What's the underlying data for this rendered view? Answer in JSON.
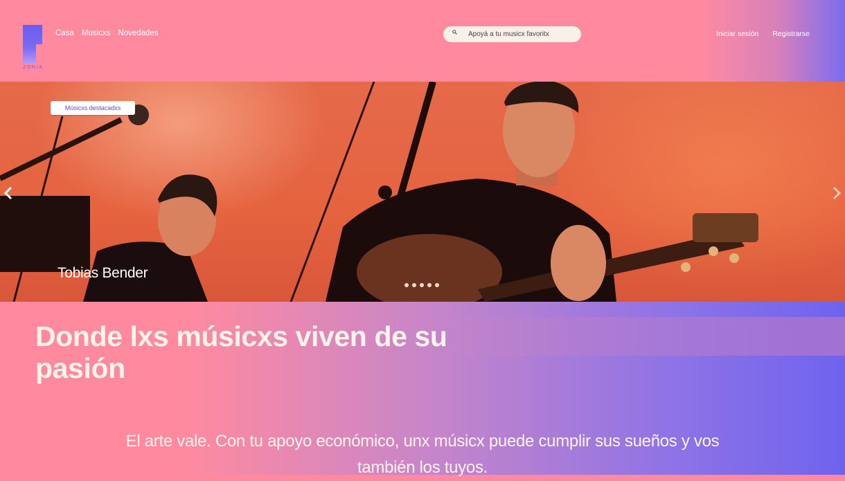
{
  "brand": {
    "logo_text": "ZONIA"
  },
  "nav": {
    "items": [
      {
        "label": "Casa"
      },
      {
        "label": "Musicxs"
      },
      {
        "label": "Novedades"
      }
    ]
  },
  "search": {
    "placeholder": "Apoyá a tu musicx favoritx",
    "icon": "search-icon"
  },
  "auth": {
    "login_label": "Iniciar sesión",
    "register_label": "Registrarse"
  },
  "carousel": {
    "badge_label": "Músicxs destacadxs",
    "artist_name": "Tobias Bender",
    "slide_count": 5,
    "prev_icon": "chevron-left-icon",
    "next_icon": "chevron-right-icon"
  },
  "main": {
    "headline": "Donde lxs músicxs viven de su pasión",
    "subtext": "El arte vale. Con tu apoyo económico, unx músicx puede cumplir sus sueños y vos también los tuyos."
  },
  "colors": {
    "header_bg": "#ff8aa0",
    "accent": "#6a5cf0",
    "hero_orange": "#e5633f",
    "text_light": "#fff3ea"
  }
}
